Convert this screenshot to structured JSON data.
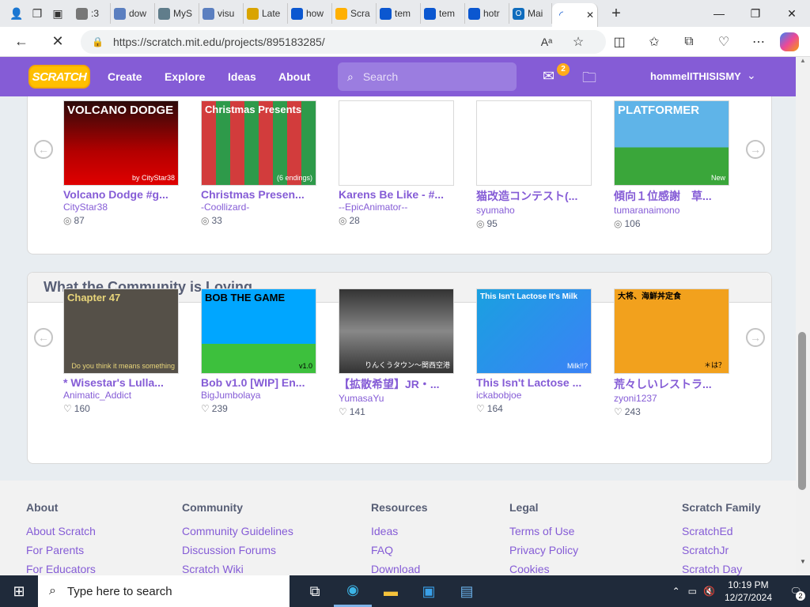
{
  "browser": {
    "tabs": [
      {
        "label": ":3",
        "favicon_color": "#777"
      },
      {
        "label": "dow",
        "favicon_color": "#5b7fc0"
      },
      {
        "label": "MyS",
        "favicon_color": "#607d8b"
      },
      {
        "label": "visu",
        "favicon_color": "#5b7fc0"
      },
      {
        "label": "Late",
        "favicon_color": "#d9a400"
      },
      {
        "label": "how",
        "favicon_color": "#0b57d0"
      },
      {
        "label": "Scra",
        "favicon_color": "#ffb000"
      },
      {
        "label": "tem",
        "favicon_color": "#0b57d0"
      },
      {
        "label": "tem",
        "favicon_color": "#0b57d0"
      },
      {
        "label": "hotr",
        "favicon_color": "#0b57d0"
      },
      {
        "label": "Mai",
        "favicon_color": "#0f6cbd"
      }
    ],
    "active_tab_close": "✕",
    "new_tab": "+",
    "url": "https://scratch.mit.edu/projects/895183285/"
  },
  "scratch_nav": {
    "logo": "SCRATCH",
    "links": [
      "Create",
      "Explore",
      "Ideas",
      "About"
    ],
    "search_placeholder": "Search",
    "message_count": "2",
    "username": "hommelITHISISMY"
  },
  "section1": {
    "projects": [
      {
        "title": "Volcano Dodge #g...",
        "author": "CityStar38",
        "views": "87",
        "thumb_text": "VOLCANO DODGE",
        "thumb_sub": "by CityStar38"
      },
      {
        "title": "Christmas Presen...",
        "author": "-Coollizard-",
        "views": "33",
        "thumb_text": "Christmas Presents",
        "thumb_sub": "(6 endings)"
      },
      {
        "title": "Karens Be Like - #...",
        "author": "--EpicAnimator--",
        "views": "28",
        "thumb_text": "",
        "thumb_sub": ""
      },
      {
        "title": "猫改造コンテスト(...",
        "author": "syumaho",
        "views": "95",
        "thumb_text": "",
        "thumb_sub": ""
      },
      {
        "title": "傾向１位感謝　草...",
        "author": "tumaranaimono",
        "views": "106",
        "thumb_text": "PLATFORMER",
        "thumb_sub": "New"
      }
    ]
  },
  "section2": {
    "heading": "What the Community is Loving",
    "projects": [
      {
        "title": "* Wisestar's Lulla...",
        "author": "Animatic_Addict",
        "loves": "160",
        "thumb_text": "Chapter 47",
        "thumb_sub": "Do you think it means something"
      },
      {
        "title": "Bob v1.0 [WIP] En...",
        "author": "BigJumbolaya",
        "loves": "239",
        "thumb_text": "BOB THE GAME",
        "thumb_sub": "v1.0"
      },
      {
        "title": "【拡散希望】JR・...",
        "author": "YumasaYu",
        "loves": "141",
        "thumb_text": "",
        "thumb_sub": "りんくうタウン〜関西空港"
      },
      {
        "title": "This Isn't Lactose ...",
        "author": "ickabobjoe",
        "loves": "164",
        "thumb_text": "This Isn't Lactose It's Milk",
        "thumb_sub": "Milk!!?"
      },
      {
        "title": "荒々しいレストラ...",
        "author": "zyoni1237",
        "loves": "243",
        "thumb_text": "大将、海鮮丼定食",
        "thumb_sub": "＊は？"
      }
    ]
  },
  "footer": {
    "columns": [
      {
        "heading": "About",
        "links": [
          "About Scratch",
          "For Parents",
          "For Educators"
        ]
      },
      {
        "heading": "Community",
        "links": [
          "Community Guidelines",
          "Discussion Forums",
          "Scratch Wiki"
        ]
      },
      {
        "heading": "Resources",
        "links": [
          "Ideas",
          "FAQ",
          "Download"
        ]
      },
      {
        "heading": "Legal",
        "links": [
          "Terms of Use",
          "Privacy Policy",
          "Cookies"
        ]
      },
      {
        "heading": "Scratch Family",
        "links": [
          "ScratchEd",
          "ScratchJr",
          "Scratch Day"
        ]
      }
    ]
  },
  "taskbar": {
    "search_placeholder": "Type here to search",
    "time": "10:19 PM",
    "date": "12/27/2024",
    "notification_count": "2"
  }
}
